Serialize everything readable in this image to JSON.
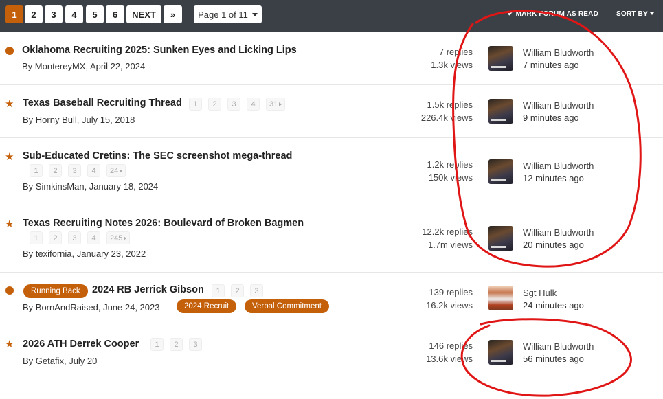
{
  "pagination": {
    "pages": [
      "1",
      "2",
      "3",
      "4",
      "5",
      "6"
    ],
    "next_label": "NEXT",
    "last_label": "»",
    "page_selector_label": "Page 1 of 11"
  },
  "top_actions": {
    "mark_read_label": "MARK FORUM AS READ",
    "sort_label": "SORT BY"
  },
  "threads": [
    {
      "marker": "unread-dot",
      "prefix": "",
      "title": "Oklahoma Recruiting 2025: Sunken Eyes and Licking Lips",
      "byline": "By MontereyMX, April 22, 2024",
      "mini_pages": [],
      "tags": [],
      "replies": "7 replies",
      "views": "1.3k views",
      "last_poster": "William Bludworth",
      "last_time": "7 minutes ago"
    },
    {
      "marker": "star",
      "prefix": "",
      "title": "Texas Baseball Recruiting Thread",
      "byline": "By Horny Bull, July 15, 2018",
      "mini_pages": [
        "1",
        "2",
        "3",
        "4",
        "31"
      ],
      "tags": [],
      "replies": "1.5k replies",
      "views": "226.4k views",
      "last_poster": "William Bludworth",
      "last_time": "9 minutes ago"
    },
    {
      "marker": "star",
      "prefix": "",
      "title": "Sub-Educated Cretins: The SEC screenshot mega-thread",
      "byline": "By SimkinsMan, January 18, 2024",
      "mini_pages": [
        "1",
        "2",
        "3",
        "4",
        "24"
      ],
      "tags": [],
      "replies": "1.2k replies",
      "views": "150k views",
      "last_poster": "William Bludworth",
      "last_time": "12 minutes ago"
    },
    {
      "marker": "star",
      "prefix": "",
      "title": "Texas Recruiting Notes 2026: Boulevard of Broken Bagmen",
      "byline": "By texifornia, January 23, 2022",
      "mini_pages": [
        "1",
        "2",
        "3",
        "4",
        "245"
      ],
      "tags": [],
      "replies": "12.2k replies",
      "views": "1.7m views",
      "last_poster": "William Bludworth",
      "last_time": "20 minutes ago"
    },
    {
      "marker": "unread-dot",
      "prefix": "Running Back",
      "title": "2024 RB Jerrick Gibson",
      "byline": "By BornAndRaised, June 24, 2023",
      "mini_pages": [
        "1",
        "2",
        "3"
      ],
      "tags": [
        "2024 Recruit",
        "Verbal Commitment"
      ],
      "replies": "139 replies",
      "views": "16.2k views",
      "last_poster": "Sgt Hulk",
      "last_time": "24 minutes ago"
    },
    {
      "marker": "star",
      "prefix": "",
      "title": "2026 ATH Derrek Cooper",
      "byline": "By Getafix, July 20",
      "mini_pages": [
        "1",
        "2",
        "3"
      ],
      "tags": [],
      "replies": "146 replies",
      "views": "13.6k views",
      "last_poster": "William Bludworth",
      "last_time": "56 minutes ago"
    }
  ],
  "colors": {
    "accent": "#c45f0a",
    "topbar": "#3b4046",
    "annotation_ink": "#e01616"
  }
}
